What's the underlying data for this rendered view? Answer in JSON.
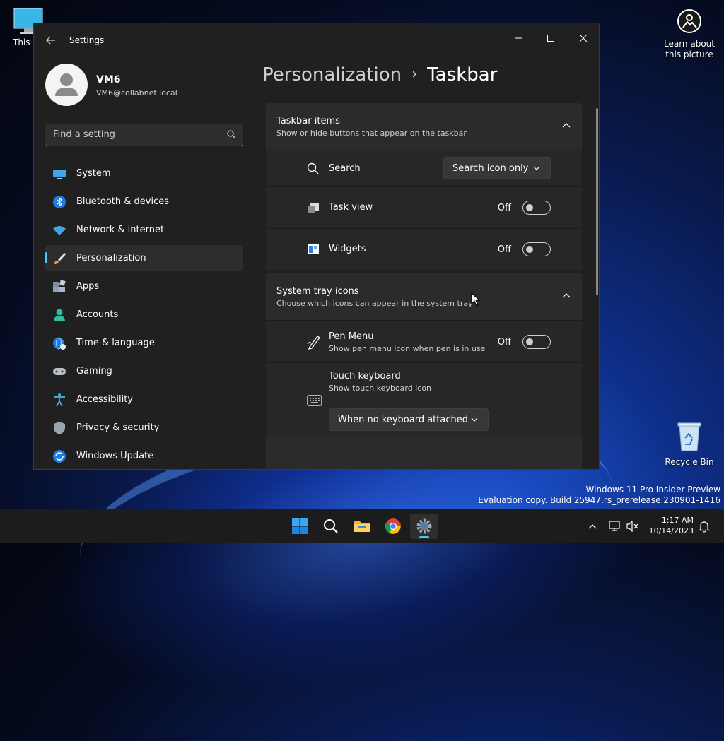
{
  "desktop": {
    "this_pc_label": "This PC",
    "learn_label_1": "Learn about",
    "learn_label_2": "this picture",
    "recycle_label": "Recycle Bin",
    "watermark_line1": "Windows 11 Pro Insider Preview",
    "watermark_line2": "Evaluation copy. Build 25947.rs_prerelease.230901-1416"
  },
  "window": {
    "title": "Settings"
  },
  "profile": {
    "name": "VM6",
    "email": "VM6@collabnet.local"
  },
  "search": {
    "placeholder": "Find a setting"
  },
  "nav": {
    "items": [
      {
        "label": "System",
        "icon": "monitor-icon"
      },
      {
        "label": "Bluetooth & devices",
        "icon": "bluetooth-icon"
      },
      {
        "label": "Network & internet",
        "icon": "wifi-icon"
      },
      {
        "label": "Personalization",
        "icon": "brush-icon",
        "active": true
      },
      {
        "label": "Apps",
        "icon": "apps-icon"
      },
      {
        "label": "Accounts",
        "icon": "person-icon"
      },
      {
        "label": "Time & language",
        "icon": "globe-clock-icon"
      },
      {
        "label": "Gaming",
        "icon": "gamepad-icon"
      },
      {
        "label": "Accessibility",
        "icon": "accessibility-icon"
      },
      {
        "label": "Privacy & security",
        "icon": "shield-icon"
      },
      {
        "label": "Windows Update",
        "icon": "update-icon"
      }
    ]
  },
  "breadcrumb": {
    "parent": "Personalization",
    "current": "Taskbar"
  },
  "taskbar_items": {
    "title": "Taskbar items",
    "subtitle": "Show or hide buttons that appear on the taskbar",
    "search_label": "Search",
    "search_value": "Search icon only",
    "taskview_label": "Task view",
    "taskview_state": "Off",
    "widgets_label": "Widgets",
    "widgets_state": "Off"
  },
  "system_tray": {
    "title": "System tray icons",
    "subtitle": "Choose which icons can appear in the system tray",
    "pen_label": "Pen Menu",
    "pen_sub": "Show pen menu icon when pen is in use",
    "pen_state": "Off",
    "touch_label": "Touch keyboard",
    "touch_sub": "Show touch keyboard icon",
    "touch_value": "When no keyboard attached"
  },
  "clock": {
    "time": "1:17 AM",
    "date": "10/14/2023"
  },
  "colors": {
    "accent": "#4cc2ff",
    "window_bg": "#202020",
    "card_bg": "#2b2b2b"
  }
}
